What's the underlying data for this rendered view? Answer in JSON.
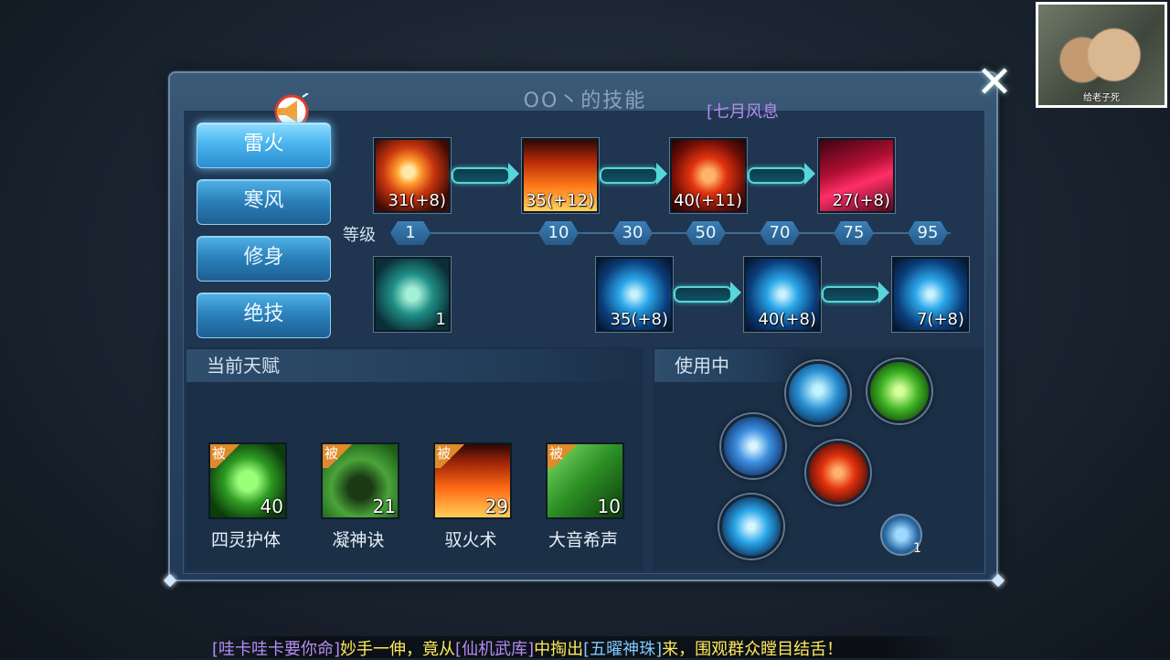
{
  "window": {
    "title": "OO丶的技能",
    "player_tag": "[七月风息",
    "close_icon": "close-x"
  },
  "webcam": {
    "caption": "给老子死"
  },
  "tabs": [
    {
      "label": "雷火",
      "active": true
    },
    {
      "label": "寒风",
      "active": false
    },
    {
      "label": "修身",
      "active": false
    },
    {
      "label": "绝技",
      "active": false
    }
  ],
  "skill_tree": {
    "row1": [
      {
        "icon": "fireball-icon",
        "level": "31(+8)"
      },
      {
        "icon": "flame-pillar-icon",
        "level": "35(+12)"
      },
      {
        "icon": "fire-feather-icon",
        "level": "40(+11)"
      },
      {
        "icon": "crimson-claw-icon",
        "level": "27(+8)"
      }
    ],
    "level_label": "等级",
    "levels": [
      "1",
      "10",
      "30",
      "50",
      "70",
      "75",
      "95"
    ],
    "row2": [
      {
        "icon": "thunder-fist-icon",
        "level": "1"
      },
      {
        "icon": "lightning-icon",
        "level": "35(+8)"
      },
      {
        "icon": "lightning-storm-icon",
        "level": "40(+8)"
      },
      {
        "icon": "lightning-bolt-icon",
        "level": "7(+8)"
      }
    ]
  },
  "talents": {
    "header": "当前天赋",
    "passive_badge": "被",
    "items": [
      {
        "name": "四灵护体",
        "level": "40",
        "icon": "shield-face-icon"
      },
      {
        "name": "凝神诀",
        "level": "21",
        "icon": "meditate-icon"
      },
      {
        "name": "驭火术",
        "level": "29",
        "icon": "fire-control-icon"
      },
      {
        "name": "大音希声",
        "level": "10",
        "icon": "sound-silhouette-icon"
      }
    ]
  },
  "in_use": {
    "header": "使用中",
    "orbs": [
      "praying-man-icon",
      "running-man-icon",
      "grab-hand-icon",
      "fire-slash-icon",
      "lightning-icon"
    ],
    "swap_count": "1"
  },
  "ticker": {
    "parts": [
      {
        "text": "[哇卡哇卡要你命]",
        "color": "purple"
      },
      {
        "text": "妙手一伸，竟从",
        "color": "yellow"
      },
      {
        "text": "[仙机武库]",
        "color": "purple"
      },
      {
        "text": "中掏出",
        "color": "yellow"
      },
      {
        "text": "[五曜神珠]",
        "color": "blue"
      },
      {
        "text": "来，围观群众瞠目结舌！",
        "color": "yellow"
      }
    ]
  }
}
